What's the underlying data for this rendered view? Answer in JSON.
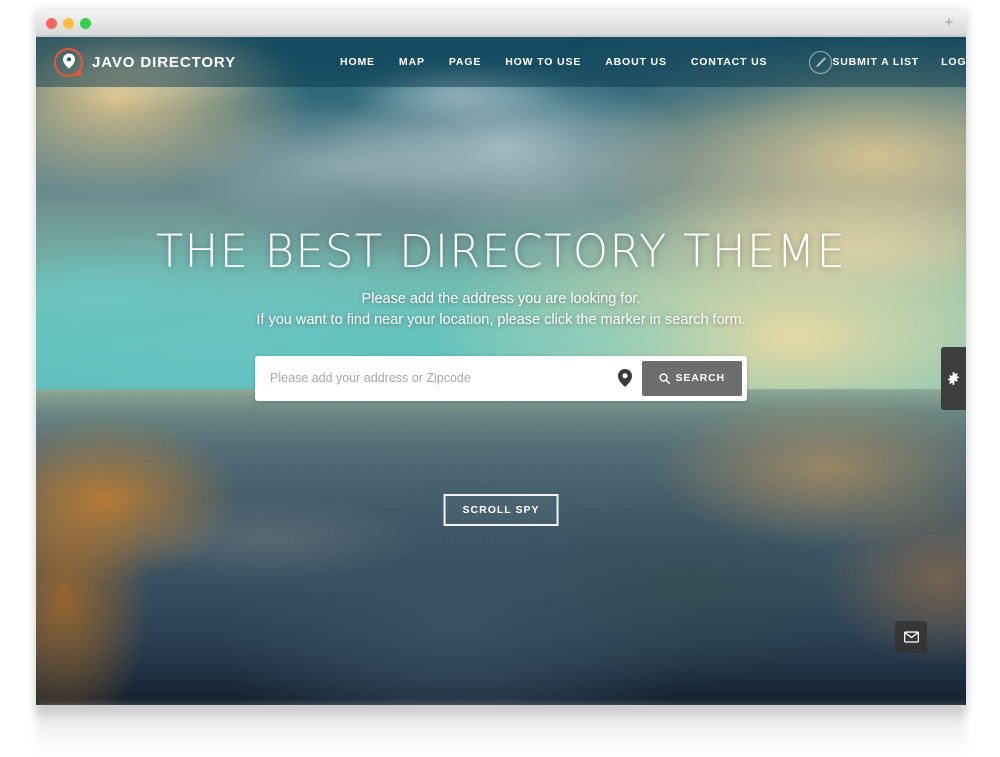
{
  "browser": {
    "traffic_lights": [
      "close",
      "minimize",
      "maximize"
    ],
    "new_tab_label": "+",
    "colors": {
      "close": "#f9655b",
      "minimize": "#fdbc40",
      "maximize": "#35cd4b",
      "chrome_bg": "#e8e8e8"
    }
  },
  "site": {
    "brand": {
      "name": "JAVO DIRECTORY",
      "icon": "map-pin-circle-logo",
      "accent_color": "#e8563a"
    },
    "nav": {
      "items": [
        {
          "label": "HOME"
        },
        {
          "label": "MAP"
        },
        {
          "label": "PAGE"
        },
        {
          "label": "HOW TO USE"
        },
        {
          "label": "ABOUT US"
        },
        {
          "label": "CONTACT US"
        }
      ],
      "circle_icon": "pencil-circle-icon",
      "right_items": [
        {
          "label": "SUBMIT A LIST"
        },
        {
          "label": "LOGIN"
        }
      ],
      "right_icons": [
        {
          "icon": "hamburger-menu-icon"
        },
        {
          "icon": "folder-icon"
        }
      ]
    },
    "hero": {
      "title": "THE BEST DIRECTORY THEME",
      "subtitle_line1": "Please add the address you are looking for.",
      "subtitle_line2": "If you want to find near your location, please click the marker in search form.",
      "search": {
        "placeholder": "Please add your address or Zipcode",
        "value": "",
        "marker_icon": "map-marker-icon",
        "search_icon": "magnifier-icon",
        "button_label": "SEARCH",
        "button_color": "#6d6d6d"
      },
      "scroll_spy_label": "SCROLL SPY"
    },
    "widgets": {
      "settings_tab": {
        "icon": "gear-icon",
        "background": "#3d3d3d"
      },
      "mail_button": {
        "icon": "envelope-icon"
      }
    },
    "background": {
      "description": "blurred aerial photo of London skyline with River Thames at dusk",
      "sky_top_color": "#1c5a73",
      "sky_bottom_color": "#58bdbb",
      "city_color": "#3e586a"
    }
  }
}
